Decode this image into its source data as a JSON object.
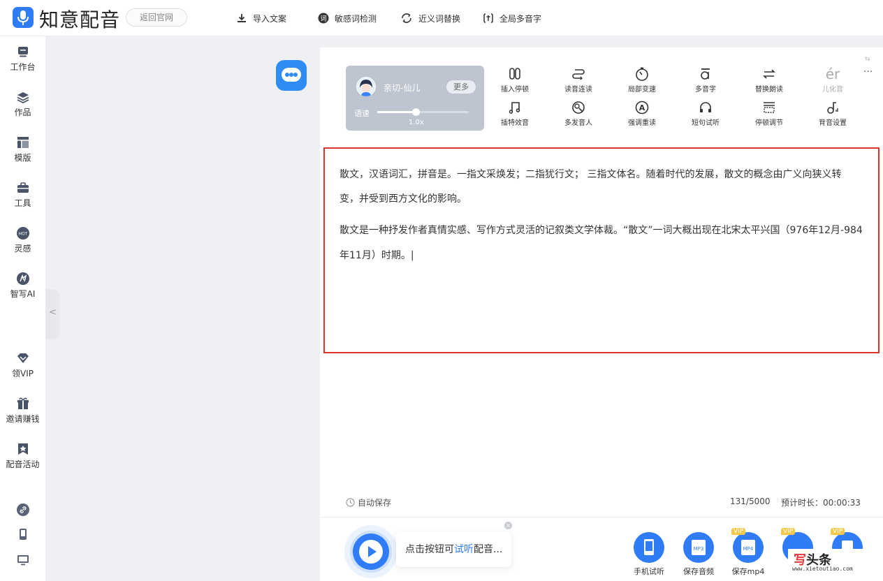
{
  "header": {
    "app_title": "知意配音",
    "back_button": "返回官网",
    "actions": [
      {
        "label": "导入文案",
        "icon": "import-icon"
      },
      {
        "label": "敏感词检测",
        "icon": "sensitive-check-icon"
      },
      {
        "label": "近义词替换",
        "icon": "synonym-replace-icon"
      },
      {
        "label": "全局多音字",
        "icon": "polyphone-global-icon"
      }
    ]
  },
  "sidebar": {
    "items": [
      {
        "label": "工作台",
        "icon": "workbench-icon"
      },
      {
        "label": "作品",
        "icon": "works-icon"
      },
      {
        "label": "模版",
        "icon": "template-icon"
      },
      {
        "label": "工具",
        "icon": "toolbox-icon"
      },
      {
        "label": "灵感",
        "icon": "hot-icon",
        "badge": "HOT"
      },
      {
        "label": "智写AI",
        "icon": "ai-write-icon"
      },
      {
        "label": "领VIP",
        "icon": "vip-diamond-icon"
      },
      {
        "label": "邀请赚钱",
        "icon": "gift-icon"
      },
      {
        "label": "配音活动",
        "icon": "activity-star-icon"
      }
    ],
    "bottom_icons": [
      "link-icon",
      "mobile-icon",
      "desktop-icon"
    ],
    "collapse_glyph": "<"
  },
  "voice": {
    "name": "亲切-仙儿",
    "more_label": "更多",
    "speed_label": "语速",
    "speed_value": "1.0x",
    "speed_fraction": 0.43
  },
  "toolbar": {
    "row1": [
      {
        "label": "插入停顿",
        "icon": "pause-insert-icon"
      },
      {
        "label": "读音连读",
        "icon": "liaison-icon"
      },
      {
        "label": "局部变速",
        "icon": "local-speed-icon"
      },
      {
        "label": "多音字",
        "icon": "polyphone-icon"
      },
      {
        "label": "替换朗读",
        "icon": "replace-read-icon"
      },
      {
        "label": "儿化音",
        "icon": "erhua-icon",
        "glyph": "ér",
        "disabled": true
      }
    ],
    "row2": [
      {
        "label": "插特效音",
        "icon": "sound-effect-icon"
      },
      {
        "label": "多发音人",
        "icon": "multi-speaker-icon"
      },
      {
        "label": "强调重读",
        "icon": "emphasis-icon"
      },
      {
        "label": "短句试听",
        "icon": "headphone-icon"
      },
      {
        "label": "停顿调节",
        "icon": "pause-adjust-icon"
      },
      {
        "label": "背音设置",
        "icon": "bgm-icon"
      }
    ],
    "more_glyph": "···"
  },
  "editor": {
    "lines": [
      "散文，汉语词汇，拼音是。一指文采焕发；二指犹行文； 三指文体名。随着时代的发展，散文的概念由广义向狭义转",
      "变，并受到西方文化的影响。",
      "散文是一种抒发作者真情实感、写作方式灵活的记叙类文学体裁。“散文”一词大概出现在北宋太平兴国（976年12月-984",
      "年11月）时期。|"
    ]
  },
  "status": {
    "autosave": "自动保存",
    "counter": "131/5000",
    "duration": "预计时长：00:00:33"
  },
  "player": {
    "tip_prefix": "点击按钮可",
    "tip_highlight": "试听",
    "tip_suffix": "配音...",
    "close_glyph": "×"
  },
  "exports": [
    {
      "label": "手机试听",
      "icon": "phone-listen-icon",
      "vip": false
    },
    {
      "label": "保存音频",
      "icon": "mp3-icon",
      "tag": "MP3",
      "vip": false
    },
    {
      "label": "保存mp4",
      "icon": "mp4-icon",
      "tag": "MP4",
      "vip": true
    },
    {
      "label": "",
      "icon": "export-icon",
      "vip": true
    },
    {
      "label": "",
      "icon": "export-icon",
      "vip": true
    }
  ],
  "vip_label": "VIP",
  "watermark": {
    "main_red": "写",
    "main": "头条",
    "sub": "www.xietoutiao.com"
  },
  "colors": {
    "accent": "#2f7cf6",
    "highlight_border": "#d9342b"
  }
}
